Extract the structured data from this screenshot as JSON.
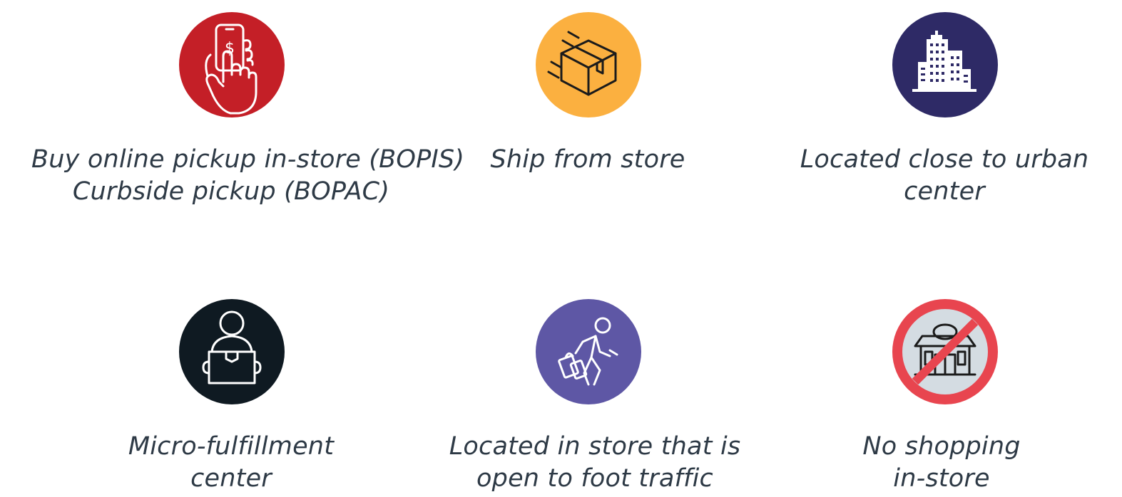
{
  "items": [
    {
      "icon": "hand-phone-dollar-icon",
      "color": "#c41f27",
      "lines": [
        "Buy online pickup in-store (BOPIS)",
        "Curbside pickup (BOPAC)"
      ]
    },
    {
      "icon": "shipping-box-icon",
      "color": "#fbb040",
      "lines": [
        "Ship from store"
      ]
    },
    {
      "icon": "city-buildings-icon",
      "color": "#2e2a66",
      "lines": [
        "Located close to urban",
        "center"
      ]
    },
    {
      "icon": "person-holding-box-icon",
      "color": "#0f1a22",
      "lines": [
        "Micro-fulfillment",
        "center"
      ]
    },
    {
      "icon": "walking-shopper-icon",
      "color": "#5e57a5",
      "lines": [
        "Located in store that is",
        "open to foot traffic"
      ]
    },
    {
      "icon": "no-store-icon",
      "color": "#e8454f",
      "lines": [
        "No shopping",
        "in-store"
      ]
    }
  ]
}
